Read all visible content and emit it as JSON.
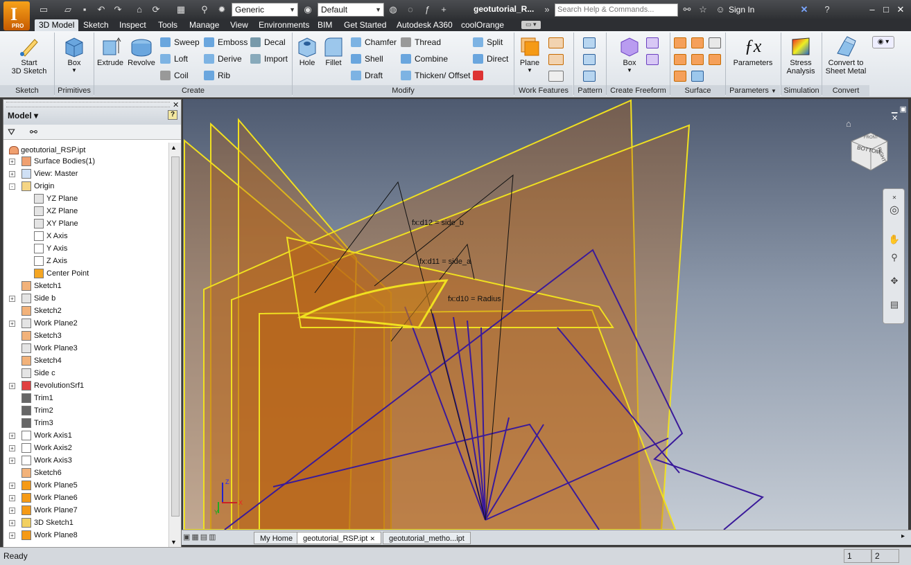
{
  "app": {
    "logo_letter": "I",
    "logo_sub": "PRO"
  },
  "titlebar": {
    "doc_title": "geotutorial_R...",
    "search_placeholder": "Search Help & Commands...",
    "sign_in": "Sign In",
    "material_dropdown": "Generic",
    "appearance_dropdown": "Default"
  },
  "tabs": [
    "3D Model",
    "Sketch",
    "Inspect",
    "Tools",
    "Manage",
    "View",
    "Environments",
    "BIM",
    "Get Started",
    "Autodesk A360",
    "coolOrange"
  ],
  "ribbon": {
    "sketch": {
      "start_3d_sketch": "Start\n3D Sketch",
      "label": "Sketch"
    },
    "primitives": {
      "box": "Box",
      "label": "Primitives"
    },
    "create": {
      "extrude": "Extrude",
      "revolve": "Revolve",
      "sweep": "Sweep",
      "loft": "Loft",
      "coil": "Coil",
      "emboss": "Emboss",
      "derive": "Derive",
      "rib": "Rib",
      "decal": "Decal",
      "import": "Import",
      "label": "Create"
    },
    "modify": {
      "hole": "Hole",
      "fillet": "Fillet",
      "chamfer": "Chamfer",
      "shell": "Shell",
      "draft": "Draft",
      "thread": "Thread",
      "combine": "Combine",
      "thicken_offset": "Thicken/ Offset",
      "split": "Split",
      "direct": "Direct",
      "label": "Modify"
    },
    "work_features": {
      "plane": "Plane",
      "label": "Work Features"
    },
    "pattern": {
      "label": "Pattern"
    },
    "freeform": {
      "box": "Box",
      "label": "Create Freeform"
    },
    "surface": {
      "label": "Surface"
    },
    "parameters": {
      "parameters": "Parameters",
      "label": "Parameters"
    },
    "simulation": {
      "stress": "Stress\nAnalysis",
      "label": "Simulation"
    },
    "convert": {
      "sheet_metal": "Convert to\nSheet Metal",
      "label": "Convert"
    }
  },
  "browser": {
    "title": "Model",
    "root": "geotutorial_RSP.ipt",
    "items": [
      {
        "label": "Surface Bodies(1)",
        "expand": "+",
        "level": 1,
        "icon": "surface"
      },
      {
        "label": "View: Master",
        "expand": "+",
        "level": 1,
        "icon": "view"
      },
      {
        "label": "Origin",
        "expand": "-",
        "level": 1,
        "icon": "folder"
      },
      {
        "label": "YZ Plane",
        "expand": "",
        "level": 2,
        "icon": "plane"
      },
      {
        "label": "XZ Plane",
        "expand": "",
        "level": 2,
        "icon": "plane"
      },
      {
        "label": "XY Plane",
        "expand": "",
        "level": 2,
        "icon": "plane"
      },
      {
        "label": "X Axis",
        "expand": "",
        "level": 2,
        "icon": "axis"
      },
      {
        "label": "Y Axis",
        "expand": "",
        "level": 2,
        "icon": "axis"
      },
      {
        "label": "Z Axis",
        "expand": "",
        "level": 2,
        "icon": "axis"
      },
      {
        "label": "Center Point",
        "expand": "",
        "level": 2,
        "icon": "point"
      },
      {
        "label": "Sketch1",
        "expand": "",
        "level": 1,
        "icon": "sketch"
      },
      {
        "label": "Side b",
        "expand": "+",
        "level": 1,
        "icon": "plane"
      },
      {
        "label": "Sketch2",
        "expand": "",
        "level": 1,
        "icon": "sketch"
      },
      {
        "label": "Work Plane2",
        "expand": "+",
        "level": 1,
        "icon": "plane"
      },
      {
        "label": "Sketch3",
        "expand": "",
        "level": 1,
        "icon": "sketch"
      },
      {
        "label": "Work Plane3",
        "expand": "",
        "level": 1,
        "icon": "plane"
      },
      {
        "label": "Sketch4",
        "expand": "",
        "level": 1,
        "icon": "sketch"
      },
      {
        "label": "Side c",
        "expand": "",
        "level": 1,
        "icon": "plane"
      },
      {
        "label": "RevolutionSrf1",
        "expand": "+",
        "level": 1,
        "icon": "revolve"
      },
      {
        "label": "Trim1",
        "expand": "",
        "level": 1,
        "icon": "trim"
      },
      {
        "label": "Trim2",
        "expand": "",
        "level": 1,
        "icon": "trim"
      },
      {
        "label": "Trim3",
        "expand": "",
        "level": 1,
        "icon": "trim"
      },
      {
        "label": "Work Axis1",
        "expand": "+",
        "level": 1,
        "icon": "axis"
      },
      {
        "label": "Work Axis2",
        "expand": "+",
        "level": 1,
        "icon": "axis"
      },
      {
        "label": "Work Axis3",
        "expand": "+",
        "level": 1,
        "icon": "axis"
      },
      {
        "label": "Sketch6",
        "expand": "",
        "level": 1,
        "icon": "sketch"
      },
      {
        "label": "Work Plane5",
        "expand": "+",
        "level": 1,
        "icon": "orangeplane"
      },
      {
        "label": "Work Plane6",
        "expand": "+",
        "level": 1,
        "icon": "orangeplane"
      },
      {
        "label": "Work Plane7",
        "expand": "+",
        "level": 1,
        "icon": "orangeplane"
      },
      {
        "label": "3D Sketch1",
        "expand": "+",
        "level": 1,
        "icon": "sketch3d"
      },
      {
        "label": "Work Plane8",
        "expand": "+",
        "level": 1,
        "icon": "orangeplane"
      }
    ]
  },
  "viewport": {
    "dim1": "fx:d12 = side_b",
    "dim2": "fx:d11 = side_a",
    "dim3": "fx:d10 = Radius",
    "axis_x": "X",
    "axis_y": "Y",
    "axis_z": "Z",
    "viewcube_face1": "BOTTOM",
    "viewcube_face2": "RIGHT",
    "viewcube_face3": "FRONT"
  },
  "doc_tabs": [
    "My Home",
    "geotutorial_RSP.ipt",
    "geotutorial_metho...ipt"
  ],
  "status": {
    "text": "Ready",
    "box1": "1",
    "box2": "2"
  },
  "colors": {
    "accent_orange": "#f59a16",
    "plane_yellow": "#f0e020",
    "sketch_purple": "#3a1a9a",
    "dimension": "#111111"
  }
}
